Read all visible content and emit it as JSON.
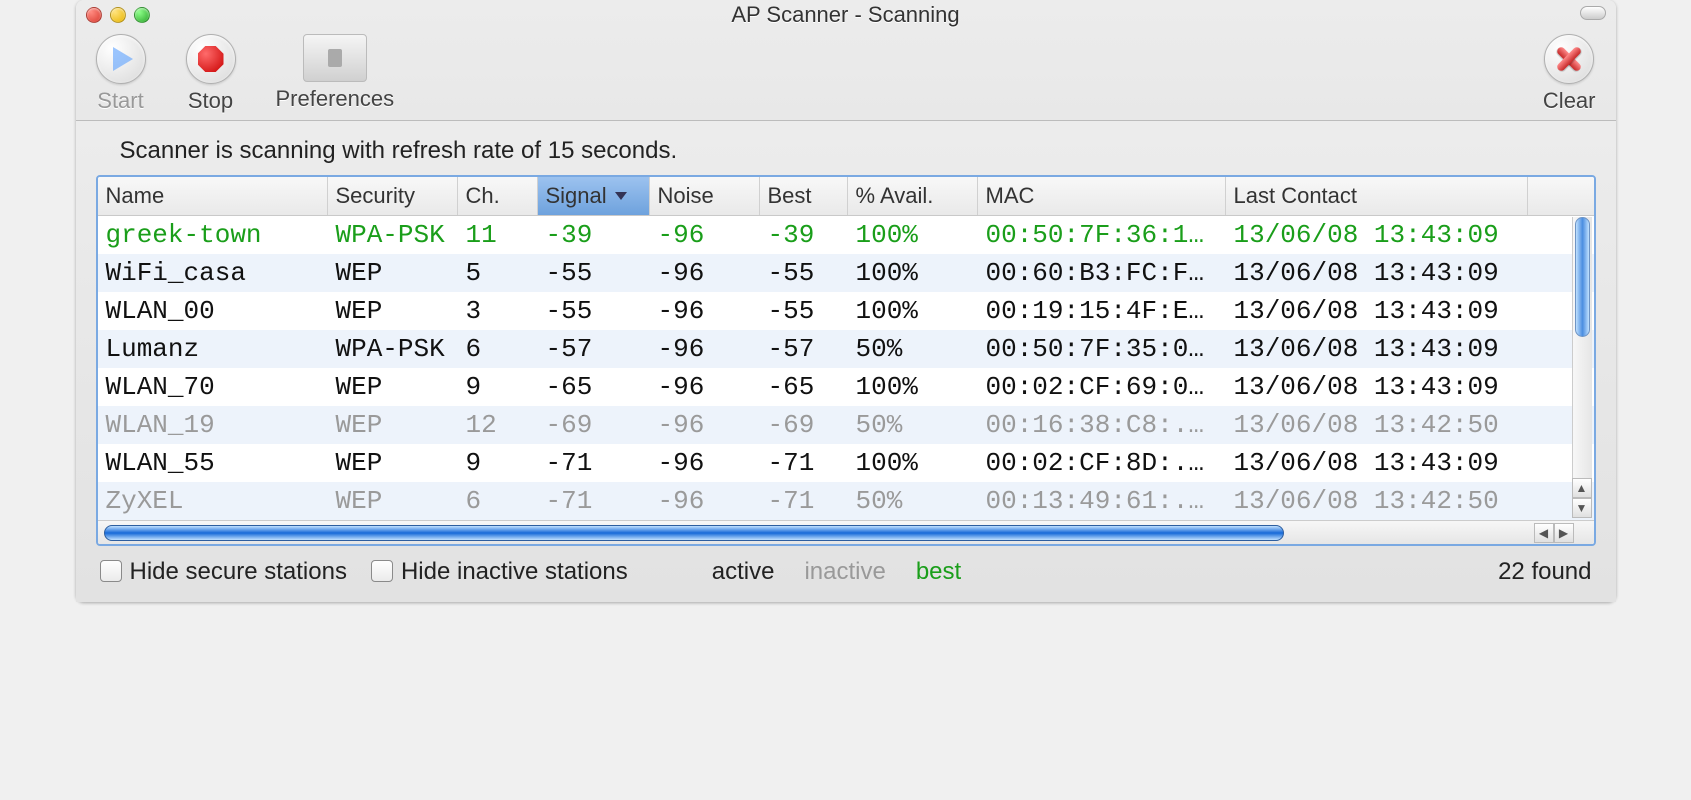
{
  "window": {
    "title": "AP Scanner - Scanning"
  },
  "toolbar": {
    "start_label": "Start",
    "stop_label": "Stop",
    "preferences_label": "Preferences",
    "clear_label": "Clear"
  },
  "status_line": "Scanner is scanning with refresh rate of 15 seconds.",
  "table": {
    "columns": {
      "name": "Name",
      "security": "Security",
      "ch": "Ch.",
      "signal": "Signal",
      "noise": "Noise",
      "best": "Best",
      "avail": "% Avail.",
      "mac": "MAC",
      "last": "Last Contact"
    },
    "sorted_column": "signal",
    "rows": [
      {
        "state": "best",
        "name": "greek-town",
        "security": "WPA-PSK",
        "ch": "11",
        "signal": "-39",
        "noise": "-96",
        "best": "-39",
        "avail": "100%",
        "mac": "00:50:7F:36:1...",
        "last": "13/06/08 13:43:09"
      },
      {
        "state": "active",
        "name": "WiFi_casa",
        "security": "WEP",
        "ch": "5",
        "signal": "-55",
        "noise": "-96",
        "best": "-55",
        "avail": "100%",
        "mac": "00:60:B3:FC:F...",
        "last": "13/06/08 13:43:09"
      },
      {
        "state": "active",
        "name": "WLAN_00",
        "security": "WEP",
        "ch": "3",
        "signal": "-55",
        "noise": "-96",
        "best": "-55",
        "avail": "100%",
        "mac": "00:19:15:4F:E...",
        "last": "13/06/08 13:43:09"
      },
      {
        "state": "active",
        "name": "Lumanz",
        "security": "WPA-PSK",
        "ch": "6",
        "signal": "-57",
        "noise": "-96",
        "best": "-57",
        "avail": "50%",
        "mac": "00:50:7F:35:0...",
        "last": "13/06/08 13:43:09"
      },
      {
        "state": "active",
        "name": "WLAN_70",
        "security": "WEP",
        "ch": "9",
        "signal": "-65",
        "noise": "-96",
        "best": "-65",
        "avail": "100%",
        "mac": "00:02:CF:69:0...",
        "last": "13/06/08 13:43:09"
      },
      {
        "state": "inactive",
        "name": "WLAN_19",
        "security": "WEP",
        "ch": "12",
        "signal": "-69",
        "noise": "-96",
        "best": "-69",
        "avail": "50%",
        "mac": "00:16:38:C8:...",
        "last": "13/06/08 13:42:50"
      },
      {
        "state": "active",
        "name": "WLAN_55",
        "security": "WEP",
        "ch": "9",
        "signal": "-71",
        "noise": "-96",
        "best": "-71",
        "avail": "100%",
        "mac": "00:02:CF:8D:...",
        "last": "13/06/08 13:43:09"
      },
      {
        "state": "inactive",
        "name": "ZyXEL",
        "security": "WEP",
        "ch": "6",
        "signal": "-71",
        "noise": "-96",
        "best": "-71",
        "avail": "50%",
        "mac": "00:13:49:61:...",
        "last": "13/06/08 13:42:50"
      }
    ]
  },
  "footer": {
    "hide_secure_label": "Hide secure stations",
    "hide_inactive_label": "Hide inactive stations",
    "legend_active": "active",
    "legend_inactive": "inactive",
    "legend_best": "best",
    "found_text": "22 found"
  }
}
